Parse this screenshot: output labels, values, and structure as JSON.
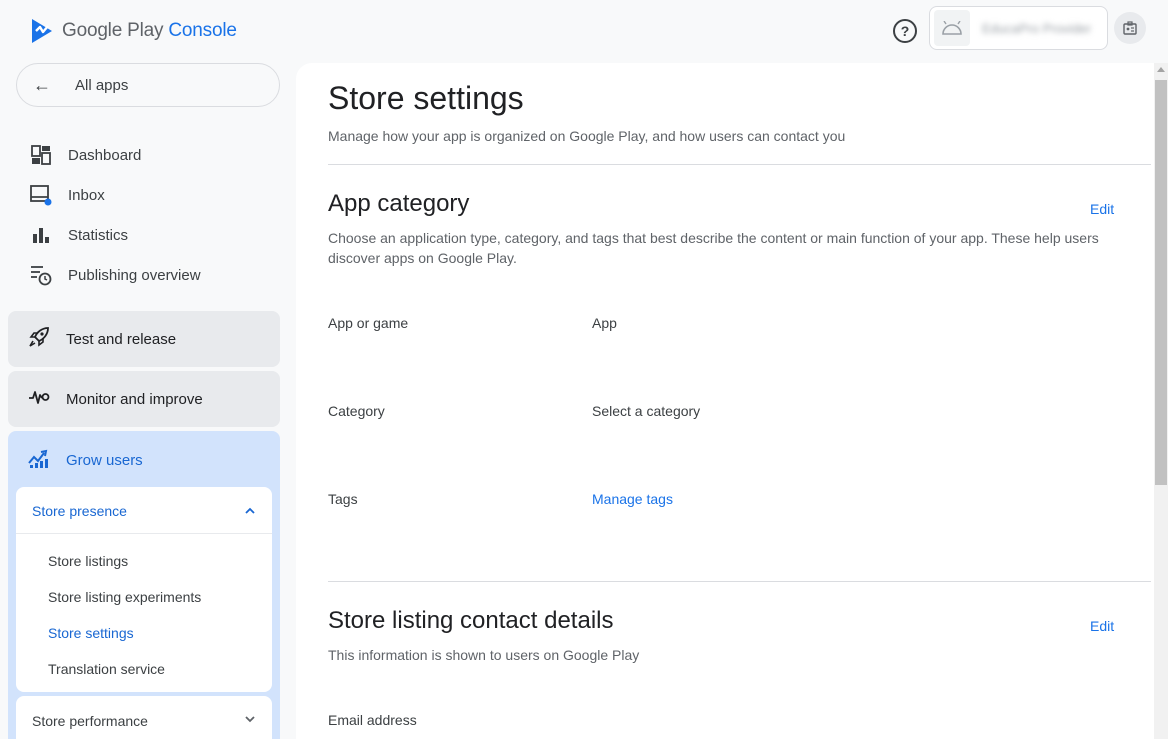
{
  "header": {
    "logo_text_1": "Google Play",
    "logo_text_2": "Console",
    "help_icon": "help-circle-icon",
    "account_name": "EducaPro Provider",
    "account_avatar_icon": "android-icon",
    "switch_icon": "account-switch-icon"
  },
  "sidebar": {
    "all_apps": "All apps",
    "nav": [
      {
        "label": "Dashboard",
        "icon": "dashboard-icon"
      },
      {
        "label": "Inbox",
        "icon": "inbox-icon"
      },
      {
        "label": "Statistics",
        "icon": "bar-chart-icon"
      },
      {
        "label": "Publishing overview",
        "icon": "publishing-icon"
      }
    ],
    "sections": [
      {
        "label": "Test and release",
        "icon": "rocket-icon"
      },
      {
        "label": "Monitor and improve",
        "icon": "vitals-icon"
      },
      {
        "label": "Grow users",
        "icon": "grow-icon"
      }
    ],
    "store_presence": {
      "title": "Store presence",
      "items": [
        "Store listings",
        "Store listing experiments",
        "Store settings",
        "Translation service"
      ],
      "active": "Store settings"
    },
    "store_performance": "Store performance"
  },
  "main": {
    "title": "Store settings",
    "subtitle": "Manage how your app is organized on Google Play, and how users can contact you",
    "app_category": {
      "title": "App category",
      "edit": "Edit",
      "description": "Choose an application type, category, and tags that best describe the content or main function of your app. These help users discover apps on Google Play.",
      "rows": [
        {
          "label": "App or game",
          "value": "App"
        },
        {
          "label": "Category",
          "value": "Select a category"
        },
        {
          "label": "Tags",
          "value": "Manage tags"
        }
      ]
    },
    "contact": {
      "title": "Store listing contact details",
      "edit": "Edit",
      "description": "This information is shown to users on Google Play",
      "rows": [
        {
          "label": "Email address"
        }
      ]
    }
  },
  "colors": {
    "accent": "#1a73e8",
    "active_nav": "#1967d2",
    "grow_bg": "#d2e3fc"
  }
}
